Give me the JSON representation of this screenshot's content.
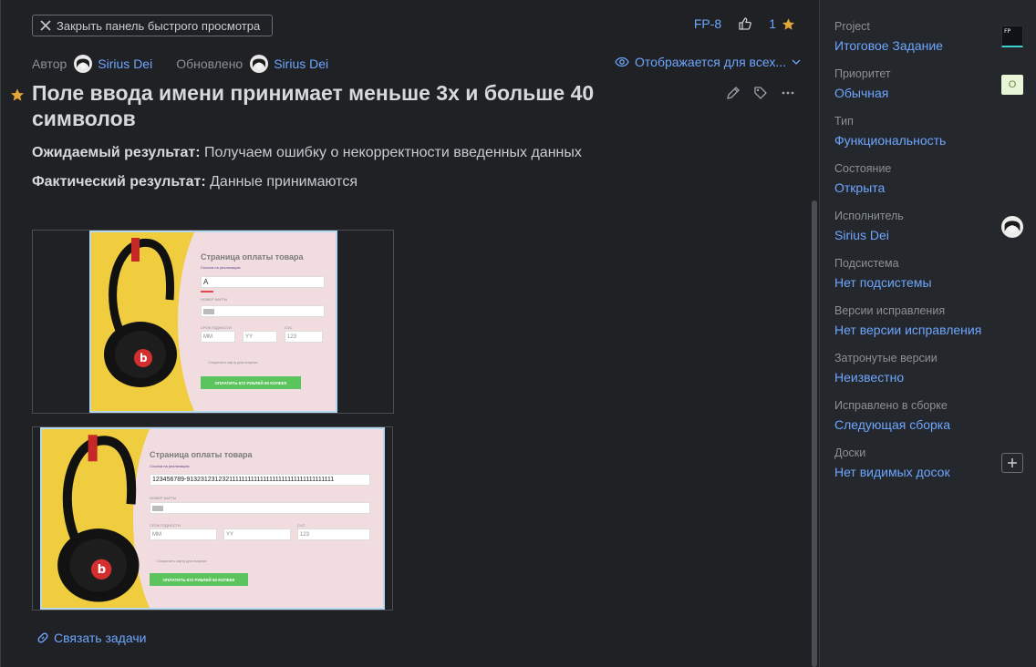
{
  "header": {
    "close_label": "Закрыть панель быстрого просмотра",
    "issue_id": "FP-8",
    "star_count": "1"
  },
  "meta": {
    "author_label": "Автор",
    "author_name": "Sirius Dei",
    "updated_label": "Обновлено",
    "updated_name": "Sirius Dei",
    "visibility": "Отображается для всех..."
  },
  "issue": {
    "title": "Поле ввода имени принимает меньше 3х и больше 40 символов",
    "expected_label": "Ожидаемый результат:",
    "expected_text": "Получаем ошибку о некорректности введенных данных",
    "actual_label": "Фактический результат:",
    "actual_text": "Данные принимаются"
  },
  "attachments": [
    {
      "page_title": "Страница оплаты товара",
      "sub_link": "Ссылка на реализацию",
      "name_value": "А",
      "card_label": "НОМЕР КАРТЫ",
      "expiry_label": "СРОК ГОДНОСТИ",
      "cvc_label": "CVC",
      "mm": "ММ",
      "yy": "YY",
      "cvc": "123",
      "save_card": "Сохранить карту для покупки",
      "pay_button": "ОПЛАТИТЬ 572 РУБЛЕЙ 60 КОПЕЕК"
    },
    {
      "page_title": "Страница оплаты товара",
      "sub_link": "Ссылка на реализацию",
      "name_value": "123456789-9132312312321111111111111111111111111111111111",
      "card_label": "НОМЕР КАРТЫ",
      "expiry_label": "СРОК ГОДНОСТИ",
      "cvc_label": "CVC",
      "mm": "ММ",
      "yy": "YY",
      "cvc": "123",
      "save_card": "Сохранить карту для покупки",
      "pay_button": "ОПЛАТИТЬ 572 РУБЛЕЙ 60 КОПЕЕК"
    }
  ],
  "link_tasks": "Связать задачи",
  "sidebar": {
    "project_label": "Project",
    "project_value": "Итоговое Задание",
    "project_badge": "FP",
    "priority_label": "Приоритет",
    "priority_value": "Обычная",
    "priority_badge": "O",
    "type_label": "Тип",
    "type_value": "Функциональность",
    "state_label": "Состояние",
    "state_value": "Открыта",
    "assignee_label": "Исполнитель",
    "assignee_value": "Sirius Dei",
    "subsystem_label": "Подсистема",
    "subsystem_value": "Нет подсистемы",
    "fix_versions_label": "Версии исправления",
    "fix_versions_value": "Нет версии исправления",
    "affected_label": "Затронутые версии",
    "affected_value": "Неизвестно",
    "fixed_in_build_label": "Исправлено в сборке",
    "fixed_in_build_value": "Следующая сборка",
    "boards_label": "Доски",
    "boards_value": "Нет видимых досок"
  },
  "colors": {
    "link": "#6ea6ff",
    "star": "#e3a43a",
    "background": "#1f2124",
    "sidebar": "#24272b"
  }
}
